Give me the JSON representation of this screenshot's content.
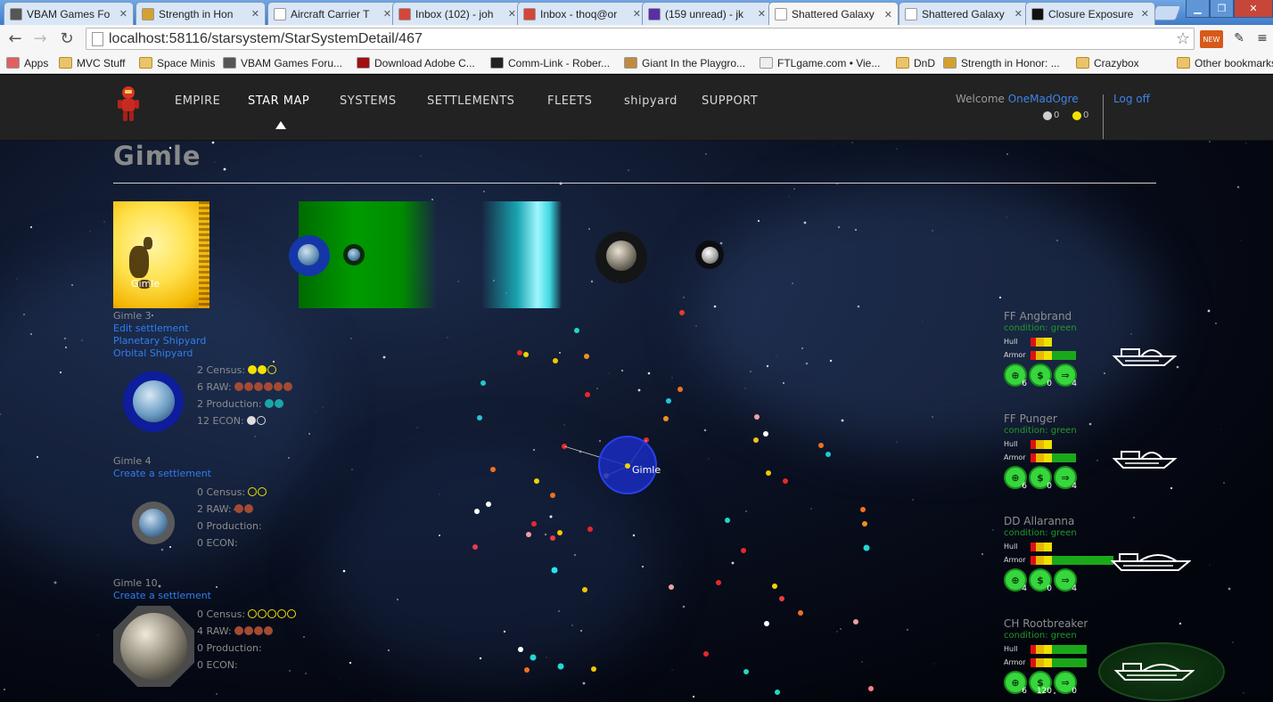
{
  "browser": {
    "tabs": [
      {
        "title": "VBAM Games Fo",
        "icon_color": "#555555"
      },
      {
        "title": "Strength in Hon",
        "icon_color": "#d4a030"
      },
      {
        "title": "Aircraft Carrier T",
        "icon_color": "#ffffff"
      },
      {
        "title": "Inbox (102) - joh",
        "icon_color": "#d44638"
      },
      {
        "title": "Inbox - thoq@or",
        "icon_color": "#d44638"
      },
      {
        "title": "(159 unread) - jk",
        "icon_color": "#5a2ea6"
      },
      {
        "title": "Shattered Galaxy",
        "icon_color": "#ffffff"
      },
      {
        "title": "Shattered Galaxy",
        "icon_color": "#ffffff"
      },
      {
        "title": "Closure Exposure",
        "icon_color": "#111111"
      }
    ],
    "active_tab_index": 6,
    "url": "localhost:58116/starsystem/StarSystemDetail/467",
    "bookmarks": [
      {
        "label": "Apps"
      },
      {
        "label": "MVC Stuff"
      },
      {
        "label": "Space Minis"
      },
      {
        "label": "VBAM Games Foru..."
      },
      {
        "label": "Download Adobe C..."
      },
      {
        "label": "Comm-Link - Rober..."
      },
      {
        "label": "Giant In the Playgro..."
      },
      {
        "label": "FTLgame.com • Vie..."
      },
      {
        "label": "DnD"
      },
      {
        "label": "Strength in Honor: ..."
      },
      {
        "label": "Crazybox"
      },
      {
        "label": "Other bookmarks"
      }
    ]
  },
  "nav": {
    "items": [
      "EMPIRE",
      "STAR MAP",
      "SYSTEMS",
      "SETTLEMENTS",
      "FLEETS",
      "shipyard",
      "SUPPORT"
    ],
    "active": "STAR MAP",
    "welcome_prefix": "Welcome",
    "username": "OneMadOgre",
    "logoff": "Log off",
    "indicators": [
      {
        "color": "#cfcfcf",
        "value": "0"
      },
      {
        "color": "#f2e200",
        "value": "0"
      }
    ]
  },
  "system": {
    "name": "Gimle",
    "star_label": "Gimle",
    "map_label": "Gimle"
  },
  "settlements": [
    {
      "planet": "Gimle 3",
      "links": [
        "Edit settlement",
        "Planetary Shipyard",
        "Orbital Shipyard"
      ],
      "stats": [
        {
          "label": "2 Census:",
          "filled": 2,
          "empty": 1,
          "color": "#f2e200"
        },
        {
          "label": "6 RAW:",
          "filled": 6,
          "empty": 0,
          "color": "#a44a32"
        },
        {
          "label": "2 Production:",
          "filled": 2,
          "empty": 0,
          "color": "#1aa6a6"
        },
        {
          "label": "12 ECON:",
          "filled": 1,
          "empty": 1,
          "color": "#dddddd"
        }
      ]
    },
    {
      "planet": "Gimle 4",
      "links": [
        "Create a settlement"
      ],
      "stats": [
        {
          "label": "0 Census:",
          "filled": 0,
          "empty": 2,
          "color": "#f2e200"
        },
        {
          "label": "2 RAW:",
          "filled": 2,
          "empty": 0,
          "color": "#a44a32"
        },
        {
          "label": "0 Production:",
          "filled": 0,
          "empty": 0,
          "color": "#1aa6a6"
        },
        {
          "label": "0 ECON:",
          "filled": 0,
          "empty": 0,
          "color": "#dddddd"
        }
      ]
    },
    {
      "planet": "Gimle 10",
      "links": [
        "Create a settlement"
      ],
      "stats": [
        {
          "label": "0 Census:",
          "filled": 0,
          "empty": 5,
          "color": "#f2e200"
        },
        {
          "label": "4 RAW:",
          "filled": 4,
          "empty": 0,
          "color": "#a44a32"
        },
        {
          "label": "0 Production:",
          "filled": 0,
          "empty": 0,
          "color": "#1aa6a6"
        },
        {
          "label": "0 ECON:",
          "filled": 0,
          "empty": 0,
          "color": "#dddddd"
        }
      ]
    }
  ],
  "ships": [
    {
      "name": "FF Angbrand",
      "condition": "condition: green",
      "hull_label": "Hull",
      "armor_label": "Armor",
      "hull": 8,
      "armor": 17,
      "stats": [
        "6",
        "0",
        "4"
      ]
    },
    {
      "name": "FF Punger",
      "condition": "condition: green",
      "hull_label": "Hull",
      "armor_label": "Armor",
      "hull": 8,
      "armor": 17,
      "stats": [
        "6",
        "0",
        "4"
      ]
    },
    {
      "name": "DD Allaranna",
      "condition": "condition: green",
      "hull_label": "Hull",
      "armor_label": "Armor",
      "hull": 8,
      "armor": 31,
      "stats": [
        "4",
        "0",
        "4"
      ]
    },
    {
      "name": "CH Rootbreaker",
      "condition": "condition: green",
      "hull_label": "Hull",
      "armor_label": "Armor",
      "hull": 21,
      "armor": 21,
      "stats": [
        "6",
        "120",
        "0"
      ]
    }
  ]
}
